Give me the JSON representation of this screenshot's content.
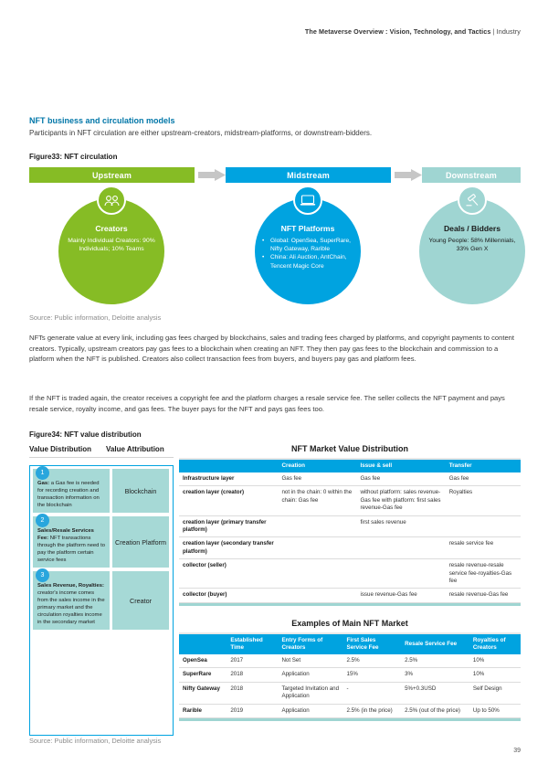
{
  "header": {
    "title": "The Metaverse Overview : Vision, Technology, and Tactics",
    "separator": "|",
    "section": "Industry"
  },
  "section": {
    "title": "NFT business and circulation models",
    "subtitle": "Participants in NFT circulation are either upstream-creators, midstream-platforms, or downstream-bidders."
  },
  "figure33": {
    "title": "Figure33: NFT circulation",
    "source": "Source: Public information, Deloitte analysis",
    "bars": [
      {
        "label": "Upstream",
        "color": "#86bc25"
      },
      {
        "label": "Midstream",
        "color": "#00a3e0"
      },
      {
        "label": "Downstream",
        "color": "#9fd5d2"
      }
    ],
    "nodes": [
      {
        "icon": "people-icon",
        "heading": "Creators",
        "body": "Mainly Individual Creators: 90% Individuals; 10% Teams",
        "color": "#86bc25"
      },
      {
        "icon": "laptop-icon",
        "heading": "NFT Platforms",
        "bullets": [
          "Global: OpenSea, SuperRare, Nifty Gateway, Rarible",
          "China: Ali Auction, AntChain, Tencent Magic Core"
        ],
        "color": "#00a3e0"
      },
      {
        "icon": "gavel-icon",
        "heading": "Deals / Bidders",
        "body": "Young People: 58% Millennials, 33% Gen X",
        "color": "#9fd5d2"
      }
    ]
  },
  "paragraphs": {
    "p1": "NFTs generate value at every link, including gas fees charged by blockchains, sales and trading fees charged by platforms, and copyright payments to content creators. Typically, upstream creators pay gas fees to a blockchain when creating an NFT. They then pay gas fees to the blockchain and commission to a platform when the NFT is published. Creators also collect transaction fees from buyers, and buyers pay gas and platform fees.",
    "p2": "If the NFT is traded again, the creator receives a copyright fee and the platform charges a resale service fee. The seller collects the NFT payment and pays resale service, royalty income, and gas fees. The buyer pays for the NFT and pays gas fees too."
  },
  "figure34": {
    "title": "Figure34: NFT value distribution",
    "source": "Source: Public information, Deloitte analysis",
    "left_panel": {
      "col1_header": "Value Distribution",
      "col2_header": "Value Attribution",
      "rows": [
        {
          "num": "1",
          "term": "Gas:",
          "desc": " a Gas fee is needed for recording creation and transaction information on the blockchain",
          "attribution": "Blockchain"
        },
        {
          "num": "2",
          "term": "Sales/Resale Services Fee:",
          "desc": " NFT transactions through the platform need to pay the platform certain service fees",
          "attribution": "Creation Platform"
        },
        {
          "num": "3",
          "term": "Sales Revenue, Royalties:",
          "desc": " creator's income comes from the sales income in the primary market and the circulation royalties income in the secondary market",
          "attribution": "Creator"
        }
      ]
    },
    "table1": {
      "title": "NFT Market Value Distribution",
      "columns": [
        "",
        "Creation",
        "Issue & sell",
        "Transfer"
      ],
      "rows": [
        [
          "Infrastructure layer",
          "Gas fee",
          "Gas fee",
          "Gas fee"
        ],
        [
          "creation layer (creator)",
          "not in the chain: 0 within the chain: Gas fee",
          "without platform: sales revenue-Gas fee with platform: first sales revenue-Gas fee",
          "Royalties"
        ],
        [
          "creation layer (primary transfer platform)",
          "",
          "first sales revenue",
          ""
        ],
        [
          "creation layer (secondary transfer platform)",
          "",
          "",
          "resale service fee"
        ],
        [
          "collector (seller)",
          "",
          "",
          "resale revenue-resale service fee-royalties-Gas fee"
        ],
        [
          "collector (buyer)",
          "",
          "issue revenue-Gas fee",
          "resale revenue-Gas fee"
        ]
      ]
    },
    "table2": {
      "title": "Examples of Main NFT Market",
      "columns": [
        "",
        "Established Time",
        "Entry Forms of Creators",
        "First Sales Service Fee",
        "Resale Service Fee",
        "Royalties of Creators"
      ],
      "rows": [
        [
          "OpenSea",
          "2017",
          "Not Set",
          "2.5%",
          "2.5%",
          "10%"
        ],
        [
          "SuperRare",
          "2018",
          "Application",
          "15%",
          "3%",
          "10%"
        ],
        [
          "Nifty Gateway",
          "2018",
          "Targeted Invitation and Application",
          "-",
          "5%+0.3USD",
          "Self Design"
        ],
        [
          "Rarible",
          "2019",
          "Application",
          "2.5% (in the price)",
          "2.5% (out of the price)",
          "Up to 50%"
        ]
      ]
    }
  },
  "page_number": "39",
  "colors": {
    "green": "#86bc25",
    "blue": "#00a3e0",
    "teal": "#9fd5d2",
    "teal_cell": "#a6d9d6",
    "heading_blue": "#0076a8"
  }
}
